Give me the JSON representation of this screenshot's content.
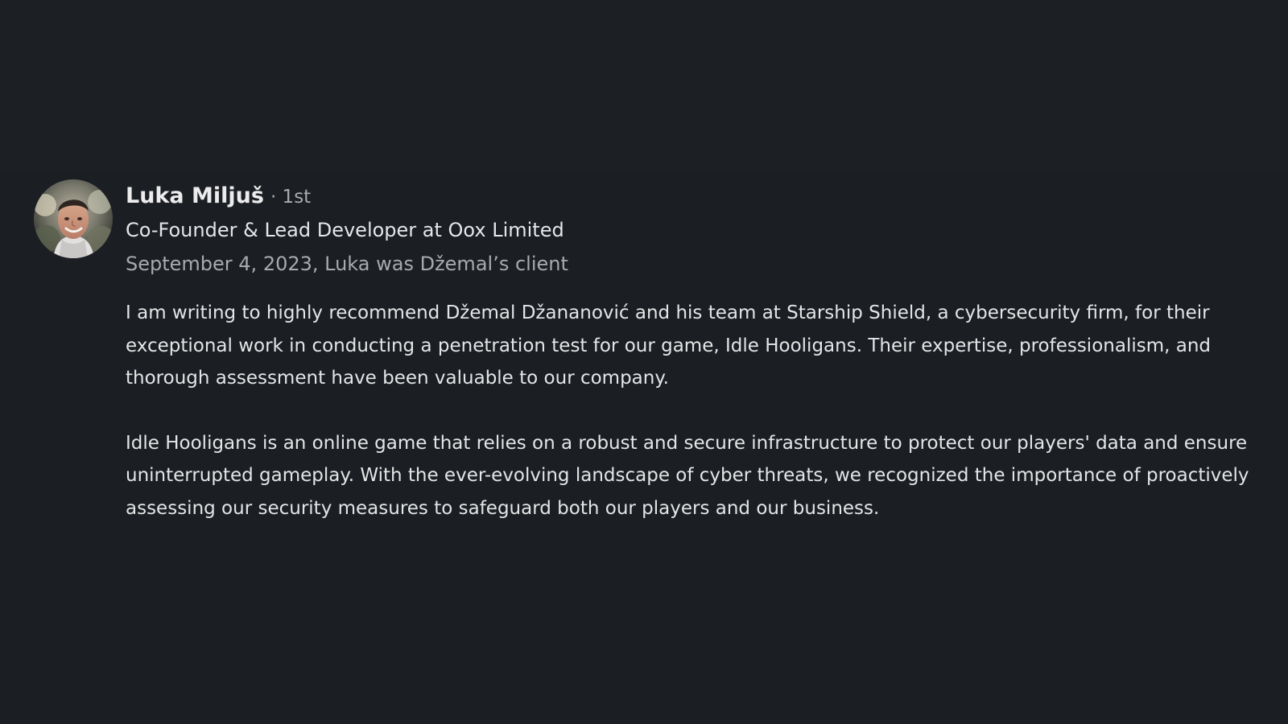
{
  "recommendation": {
    "author": {
      "name": "Luka Miljuš",
      "degree": "· 1st",
      "headline": "Co-Founder & Lead Developer at Oox Limited",
      "avatar_icon": "profile-photo"
    },
    "meta": "September 4, 2023, Luka was Džemal’s client",
    "paragraphs": [
      "I am writing to highly recommend Džemal Džananović and his team at Starship Shield, a cybersecurity firm, for their exceptional work in conducting a penetration test for our game, Idle Hooligans. Their expertise, professionalism, and thorough assessment have been valuable to our company.",
      "Idle Hooligans is an online game that relies on a robust and secure infrastructure to protect our players' data and ensure uninterrupted gameplay. With the ever-evolving landscape of cyber threats, we recognized the importance of proactively assessing our security measures to safeguard both our players and our business."
    ]
  },
  "theme": {
    "background": "#1b1e23",
    "primary_text": "#e7e9ea",
    "secondary_text": "#a8aaad"
  }
}
